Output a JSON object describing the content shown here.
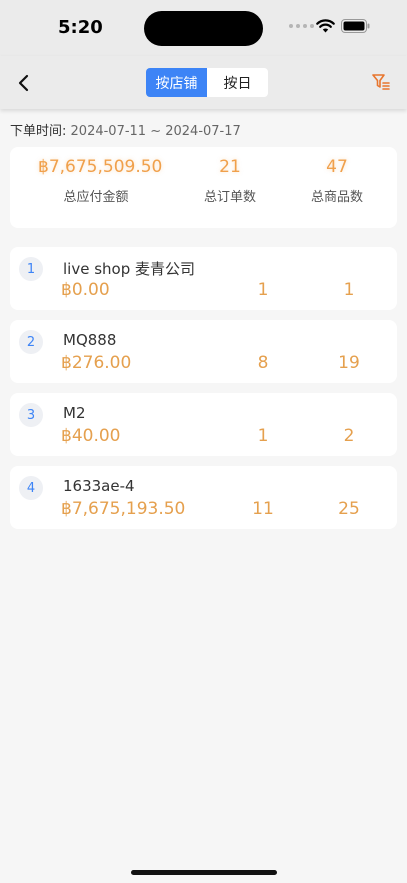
{
  "status_bar": {
    "time": "5:20"
  },
  "nav": {
    "tabs": [
      {
        "label": "按店铺",
        "active": true
      },
      {
        "label": "按日",
        "active": false
      }
    ]
  },
  "date_range": {
    "label": "下单时间:",
    "value": "2024-07-11 ~ 2024-07-17"
  },
  "summary": {
    "total_amount": "฿7,675,509.50",
    "total_amount_label": "总应付金额",
    "total_orders": "21",
    "total_orders_label": "总订单数",
    "total_items": "47",
    "total_items_label": "总商品数"
  },
  "shops": [
    {
      "rank": "1",
      "name": "live shop 麦青公司",
      "amount": "฿0.00",
      "orders": "1",
      "items": "1"
    },
    {
      "rank": "2",
      "name": "MQ888",
      "amount": "฿276.00",
      "orders": "8",
      "items": "19"
    },
    {
      "rank": "3",
      "name": "M2",
      "amount": "฿40.00",
      "orders": "1",
      "items": "2"
    },
    {
      "rank": "4",
      "name": "1633ae-4",
      "amount": "฿7,675,193.50",
      "orders": "11",
      "items": "25"
    }
  ],
  "colors": {
    "accent": "#3d84f6",
    "value": "#f0a04b",
    "background": "#f6f6f6"
  },
  "icons": [
    "back-arrow-icon",
    "filter-icon",
    "wifi-icon",
    "battery-icon",
    "signal-icon"
  ]
}
